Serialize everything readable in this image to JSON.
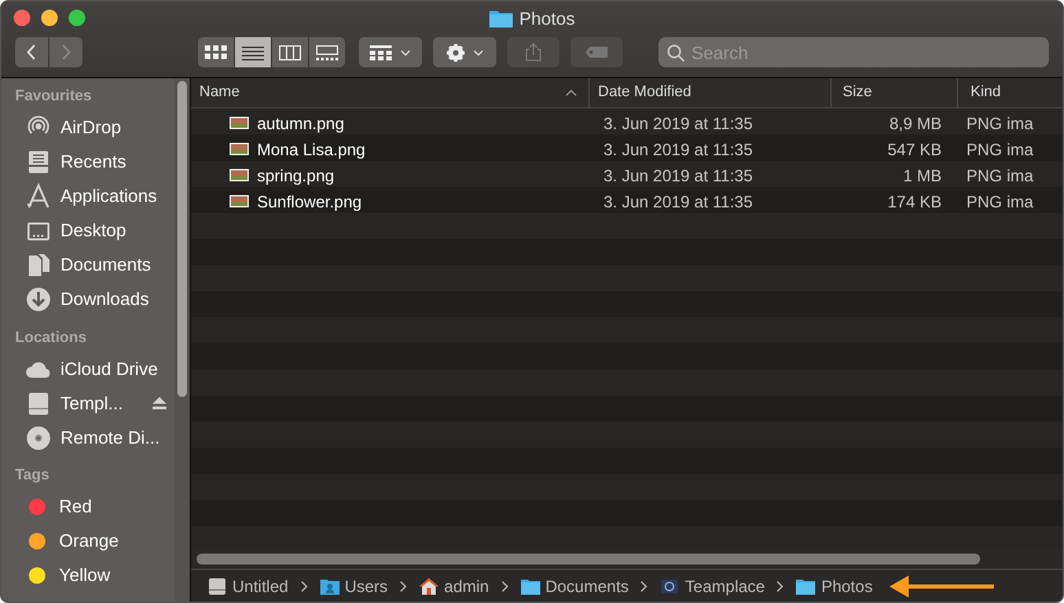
{
  "window": {
    "title": "Photos"
  },
  "toolbar": {
    "view_buttons": [
      {
        "kind": "icons",
        "selected": false
      },
      {
        "kind": "list",
        "selected": true
      },
      {
        "kind": "columns",
        "selected": false
      },
      {
        "kind": "gallery",
        "selected": false
      }
    ],
    "search": {
      "placeholder": "Search"
    }
  },
  "sidebar": {
    "sections": [
      {
        "heading": "Favourites",
        "items": [
          {
            "label": "AirDrop",
            "kind": "airdrop"
          },
          {
            "label": "Recents",
            "kind": "recents"
          },
          {
            "label": "Applications",
            "kind": "applications"
          },
          {
            "label": "Desktop",
            "kind": "desktop"
          },
          {
            "label": "Documents",
            "kind": "documents"
          },
          {
            "label": "Downloads",
            "kind": "downloads"
          }
        ]
      },
      {
        "heading": "Locations",
        "items": [
          {
            "label": "iCloud Drive",
            "kind": "icloud",
            "eject": false
          },
          {
            "label": "Templ...",
            "kind": "drive",
            "eject": true
          },
          {
            "label": "Remote Di...",
            "kind": "disc",
            "eject": false
          }
        ]
      },
      {
        "heading": "Tags",
        "items": [
          {
            "label": "Red",
            "kind": "tag",
            "color": "#ff3b47"
          },
          {
            "label": "Orange",
            "kind": "tag",
            "color": "#ffa42b"
          },
          {
            "label": "Yellow",
            "kind": "tag",
            "color": "#ffde1f"
          }
        ]
      }
    ]
  },
  "table": {
    "columns": [
      {
        "label": "Name",
        "sorted": true
      },
      {
        "label": "Date Modified",
        "sorted": false
      },
      {
        "label": "Size",
        "sorted": false
      },
      {
        "label": "Kind",
        "sorted": false
      }
    ],
    "rows": [
      {
        "name": "autumn.png",
        "date": "3. Jun 2019 at 11:35",
        "size": "8,9 MB",
        "kind": "PNG ima"
      },
      {
        "name": "Mona Lisa.png",
        "date": "3. Jun 2019 at 11:35",
        "size": "547 KB",
        "kind": "PNG ima"
      },
      {
        "name": "spring.png",
        "date": "3. Jun 2019 at 11:35",
        "size": "1 MB",
        "kind": "PNG ima"
      },
      {
        "name": "Sunflower.png",
        "date": "3. Jun 2019 at 11:35",
        "size": "174 KB",
        "kind": "PNG ima"
      }
    ]
  },
  "path_bar": [
    {
      "label": "Untitled",
      "kind": "drive"
    },
    {
      "label": "Users",
      "kind": "users"
    },
    {
      "label": "admin",
      "kind": "home"
    },
    {
      "label": "Documents",
      "kind": "folder"
    },
    {
      "label": "Teamplace",
      "kind": "app"
    },
    {
      "label": "Photos",
      "kind": "folder"
    }
  ]
}
